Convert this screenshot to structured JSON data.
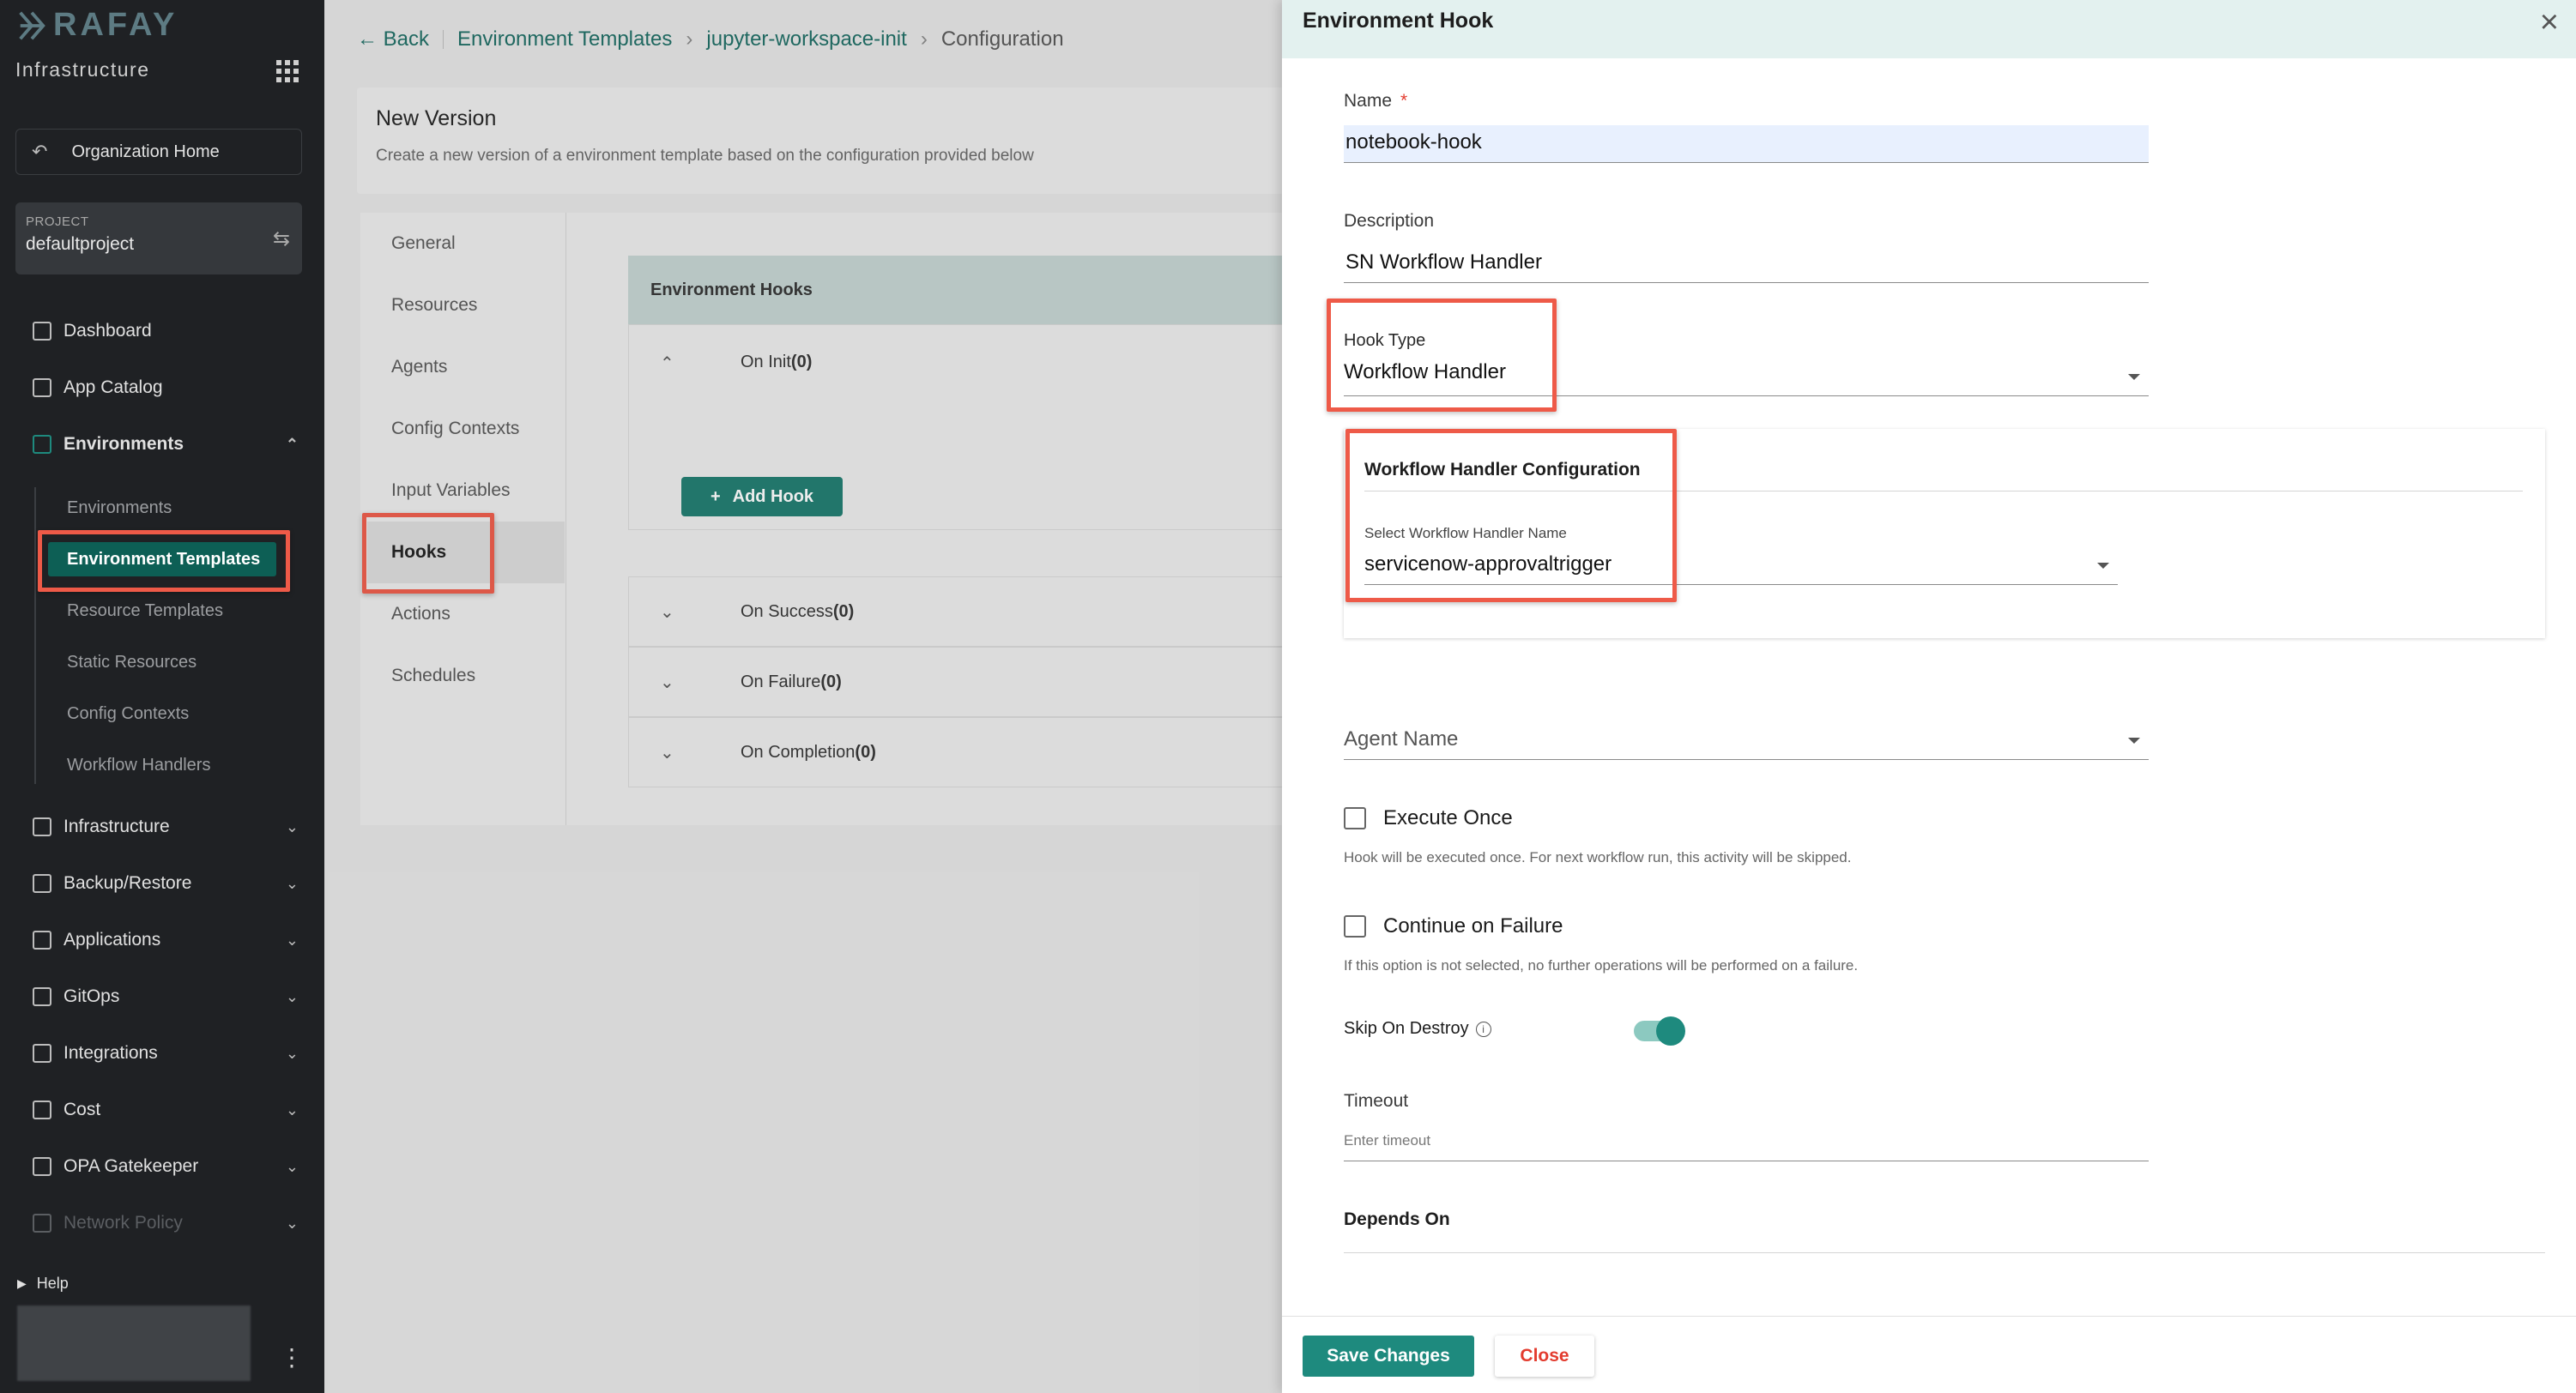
{
  "sidebar": {
    "brand": "RAFAY",
    "section_title": "Infrastructure",
    "org_home": "Organization Home",
    "project_label": "PROJECT",
    "project_name": "defaultproject",
    "nav": {
      "dashboard": "Dashboard",
      "app_catalog": "App Catalog",
      "environments": "Environments",
      "infrastructure": "Infrastructure",
      "backup_restore": "Backup/Restore",
      "applications": "Applications",
      "gitops": "GitOps",
      "integrations": "Integrations",
      "cost": "Cost",
      "opa_gatekeeper": "OPA Gatekeeper",
      "network_policy": "Network Policy"
    },
    "sub_nav": {
      "environments": "Environments",
      "environment_templates": "Environment Templates",
      "resource_templates": "Resource Templates",
      "static_resources": "Static Resources",
      "config_contexts": "Config Contexts",
      "workflow_handlers": "Workflow Handlers"
    },
    "help": "Help"
  },
  "breadcrumb": {
    "back": "Back",
    "items": [
      "Environment Templates",
      "jupyter-workspace-init",
      "Configuration"
    ]
  },
  "new_version": {
    "title": "New Version",
    "subtitle": "Create a new version of a environment template based on the configuration provided below"
  },
  "tabs": [
    "General",
    "Resources",
    "Agents",
    "Config Contexts",
    "Input Variables",
    "Hooks",
    "Actions",
    "Schedules"
  ],
  "hooks_panel": {
    "header": "Environment Hooks",
    "on_init": "On Init",
    "on_init_count": "(0)",
    "add_hook": "Add Hook",
    "on_success": "On Success",
    "on_success_count": "(0)",
    "on_failure": "On Failure",
    "on_failure_count": "(0)",
    "on_completion": "On Completion",
    "on_completion_count": "(0)"
  },
  "drawer": {
    "title": "Environment Hook",
    "name_label": "Name",
    "name_required": "*",
    "name_value": "notebook-hook",
    "description_label": "Description",
    "description_value": "SN Workflow Handler",
    "hook_type_label": "Hook Type",
    "hook_type_value": "Workflow Handler",
    "wh_config_title": "Workflow Handler Configuration",
    "wh_select_label": "Select Workflow Handler Name",
    "wh_select_value": "servicenow-approvaltrigger",
    "agent_name_placeholder": "Agent Name",
    "execute_once_label": "Execute Once",
    "execute_once_help": "Hook will be executed once. For next workflow run, this activity will be skipped.",
    "continue_on_failure_label": "Continue on Failure",
    "continue_on_failure_help": "If this option is not selected, no further operations will be performed on a failure.",
    "skip_on_destroy_label": "Skip On Destroy",
    "skip_on_destroy_enabled": true,
    "timeout_label": "Timeout",
    "timeout_placeholder": "Enter timeout",
    "depends_on_label": "Depends On",
    "save_button": "Save Changes",
    "close_button": "Close"
  },
  "colors": {
    "accent": "#1e8a7e",
    "sidebar_bg": "#1f2124",
    "highlight_box": "#ee5a48",
    "drawer_header_bg": "#e3f1ef",
    "close_text": "#e33b2e"
  },
  "icons": [
    "rafay-logo-icon",
    "apps-grid-icon",
    "back-arrow-icon",
    "swap-icon",
    "chevron-down-icon",
    "chevron-up-icon",
    "close-icon",
    "info-icon",
    "plus-icon",
    "kebab-menu-icon"
  ]
}
